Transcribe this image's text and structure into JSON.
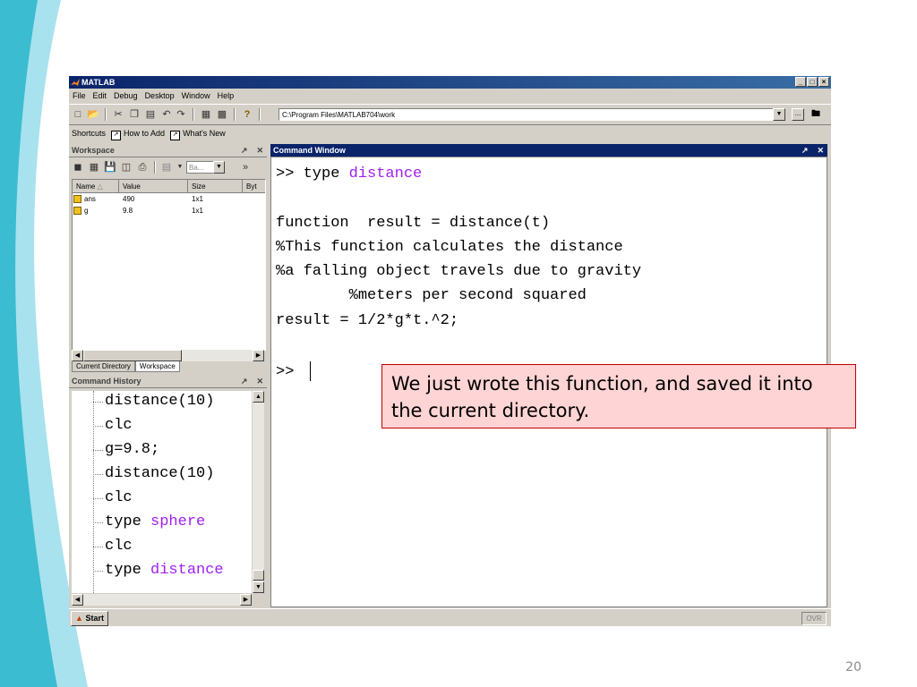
{
  "slide_number": "20",
  "window": {
    "title": "MATLAB",
    "controls": [
      "_",
      "□",
      "×"
    ]
  },
  "menu": [
    "File",
    "Edit",
    "Debug",
    "Desktop",
    "Window",
    "Help"
  ],
  "toolbar": {
    "current_directory": "C:\\Program Files\\MATLAB704\\work",
    "browse_label": "..."
  },
  "shortcuts": {
    "label": "Shortcuts",
    "items": [
      "How to Add",
      "What's New"
    ]
  },
  "workspace": {
    "title": "Workspace",
    "stack_combo": "Ba...",
    "columns": [
      "Name",
      "Value",
      "Size",
      "Byt"
    ],
    "rows": [
      {
        "name": "ans",
        "value": "490",
        "size": "1x1"
      },
      {
        "name": "g",
        "value": "9.8",
        "size": "1x1"
      }
    ],
    "tabs": [
      "Current Directory",
      "Workspace"
    ]
  },
  "history": {
    "title": "Command History",
    "lines": [
      {
        "cmd": "distance(10)",
        "arg": ""
      },
      {
        "cmd": "clc",
        "arg": ""
      },
      {
        "cmd": "g=9.8;",
        "arg": ""
      },
      {
        "cmd": "distance(10)",
        "arg": ""
      },
      {
        "cmd": "clc",
        "arg": ""
      },
      {
        "cmd": "type ",
        "arg": "sphere"
      },
      {
        "cmd": "clc",
        "arg": ""
      },
      {
        "cmd": "type ",
        "arg": "distance"
      }
    ]
  },
  "command_window": {
    "title": "Command Window",
    "prompt_cmd": ">> type ",
    "prompt_arg": "distance",
    "code": [
      "function  result = distance(t)",
      "%This function calculates the distance",
      "%a falling object travels due to gravity",
      "        %meters per second squared",
      "result = 1/2*g*t.^2;"
    ],
    "prompt": ">>"
  },
  "status": {
    "start_label": "Start",
    "ovr": "OVR"
  },
  "callout": {
    "text": "We just wrote this function, and saved it into the current directory."
  },
  "colors": {
    "title_bar": "#0a246a",
    "string_purple": "#a020f0",
    "callout_fill": "#ffd4d4",
    "callout_border": "#c00000",
    "deco_teal": "#3bbcd0",
    "deco_light": "#a8e2ee"
  }
}
